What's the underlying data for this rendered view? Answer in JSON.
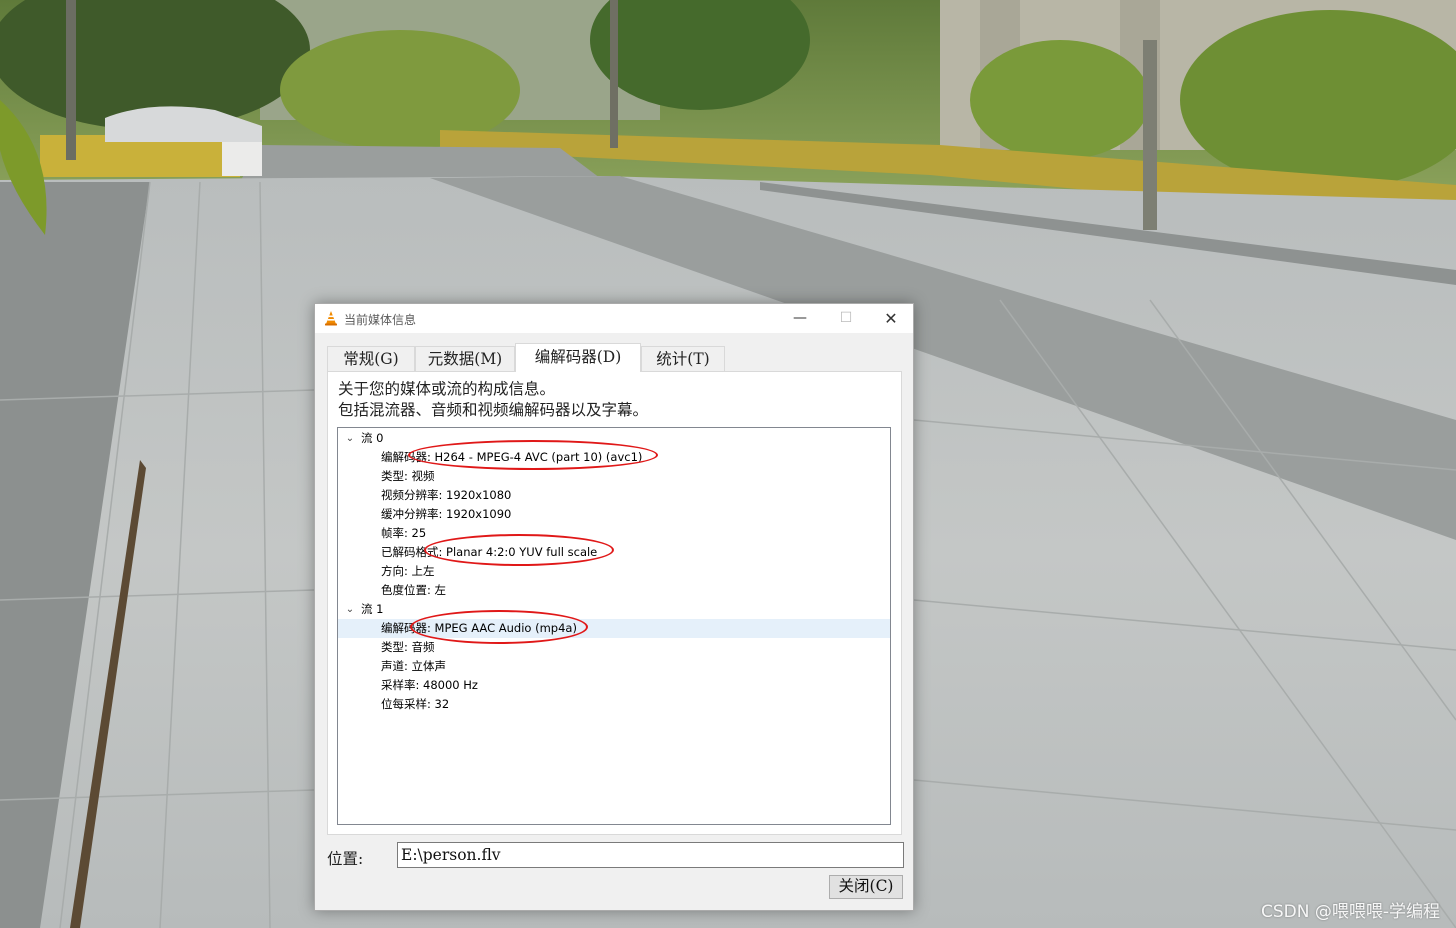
{
  "dialog": {
    "title": "当前媒体信息",
    "tabs": [
      {
        "label": "常规(G)"
      },
      {
        "label": "元数据(M)"
      },
      {
        "label": "编解码器(D)",
        "active": true
      },
      {
        "label": "统计(T)"
      }
    ],
    "intro_line1": "关于您的媒体或流的构成信息。",
    "intro_line2": "包括混流器、音频和视频编解码器以及字幕。",
    "streams": [
      {
        "label": "流 0",
        "items": [
          "编解码器: H264 - MPEG-4 AVC (part 10) (avc1)",
          "类型: 视频",
          "视频分辨率: 1920x1080",
          "缓冲分辨率: 1920x1090",
          "帧率: 25",
          "已解码格式: Planar 4:2:0 YUV full scale",
          "方向: 上左",
          "色度位置: 左"
        ]
      },
      {
        "label": "流 1",
        "items": [
          "编解码器: MPEG AAC Audio (mp4a)",
          "类型: 音频",
          "声道: 立体声",
          "采样率: 48000 Hz",
          "位每采样: 32"
        ]
      }
    ],
    "location_label": "位置:",
    "location_value": "E:\\person.flv",
    "close_label": "关闭(C)"
  },
  "watermark": "CSDN @喂喂喂-学编程",
  "colors": {
    "annotation": "#e01818",
    "selection": "#e5f0fa",
    "vlc_orange": "#f08a00"
  },
  "icons": {
    "app": "vlc-cone-icon",
    "minimize": "minimize-icon",
    "maximize": "maximize-icon",
    "close": "close-icon",
    "expand": "chevron-down-icon"
  }
}
